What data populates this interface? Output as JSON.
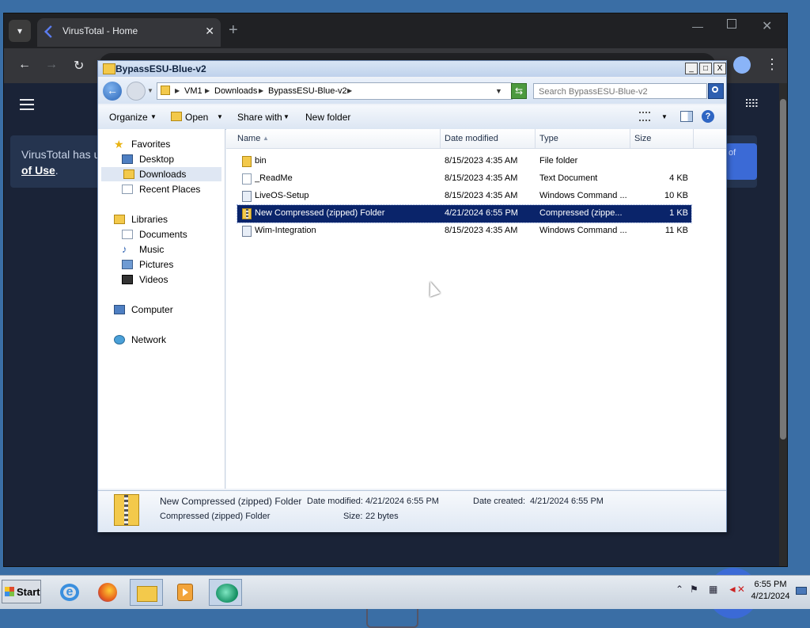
{
  "browser": {
    "tab_title": "VirusTotal - Home",
    "tab_close": "✕",
    "new_tab": "+",
    "banner_text": "VirusTotal has up",
    "banner_link": "of Use",
    "banner_after": ".",
    "banner_btn_text": "of"
  },
  "explorer": {
    "title": "BypassESU-Blue-v2",
    "breadcrumb": [
      "VM1",
      "Downloads",
      "BypassESU-Blue-v2"
    ],
    "search_placeholder": "Search BypassESU-Blue-v2",
    "commands": {
      "organize": "Organize",
      "open": "Open",
      "share_with": "Share with",
      "new_folder": "New folder"
    },
    "nav": {
      "favorites": "Favorites",
      "desktop": "Desktop",
      "downloads": "Downloads",
      "recent_places": "Recent Places",
      "libraries": "Libraries",
      "documents": "Documents",
      "music": "Music",
      "pictures": "Pictures",
      "videos": "Videos",
      "computer": "Computer",
      "network": "Network"
    },
    "columns": {
      "name": "Name",
      "date_modified": "Date modified",
      "type": "Type",
      "size": "Size"
    },
    "files": [
      {
        "name": "bin",
        "date": "8/15/2023 4:35 AM",
        "type": "File folder",
        "size": "",
        "icon": "folder-icon"
      },
      {
        "name": "_ReadMe",
        "date": "8/15/2023 4:35 AM",
        "type": "Text Document",
        "size": "4 KB",
        "icon": "text-file-icon"
      },
      {
        "name": "LiveOS-Setup",
        "date": "8/15/2023 4:35 AM",
        "type": "Windows Command ...",
        "size": "10 KB",
        "icon": "cmd-file-icon"
      },
      {
        "name": "New Compressed (zipped) Folder",
        "date": "4/21/2024 6:55 PM",
        "type": "Compressed (zippe...",
        "size": "1 KB",
        "icon": "zip-folder-icon",
        "selected": true
      },
      {
        "name": "Wim-Integration",
        "date": "8/15/2023 4:35 AM",
        "type": "Windows Command ...",
        "size": "11 KB",
        "icon": "cmd-file-icon"
      }
    ],
    "details": {
      "name": "New Compressed (zipped) Folder",
      "type": "Compressed (zipped) Folder",
      "date_modified_label": "Date modified:",
      "date_modified": "4/21/2024 6:55 PM",
      "date_created_label": "Date created:",
      "date_created": "4/21/2024 6:55 PM",
      "size_label": "Size:",
      "size": "22 bytes"
    }
  },
  "taskbar": {
    "start": "Start",
    "time": "6:55 PM",
    "date": "4/21/2024"
  }
}
